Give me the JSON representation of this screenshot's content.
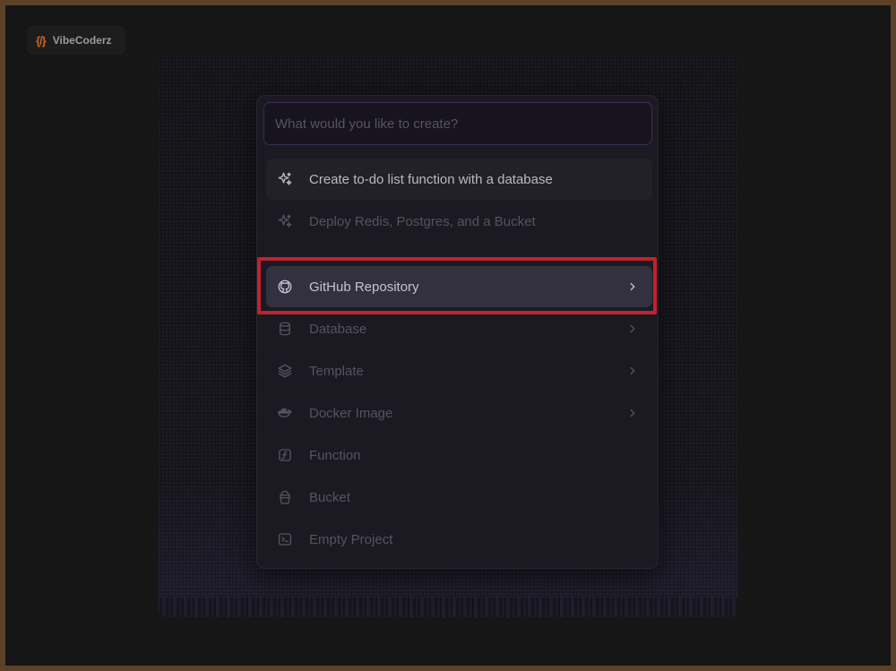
{
  "brand": {
    "logo": "{/}",
    "name": "VibeCoderz"
  },
  "search": {
    "placeholder": "What would you like to create?",
    "value": ""
  },
  "suggestions": [
    {
      "label": "Create to-do list function with a database",
      "icon": "sparkles-icon"
    },
    {
      "label": "Deploy Redis, Postgres, and a Bucket",
      "icon": "sparkles-icon"
    }
  ],
  "options": [
    {
      "label": "GitHub Repository",
      "icon": "github-icon",
      "has_submenu": true
    },
    {
      "label": "Database",
      "icon": "database-icon",
      "has_submenu": true
    },
    {
      "label": "Template",
      "icon": "layers-icon",
      "has_submenu": true
    },
    {
      "label": "Docker Image",
      "icon": "docker-icon",
      "has_submenu": true
    },
    {
      "label": "Function",
      "icon": "function-icon",
      "has_submenu": false
    },
    {
      "label": "Bucket",
      "icon": "bucket-icon",
      "has_submenu": false
    },
    {
      "label": "Empty Project",
      "icon": "terminal-icon",
      "has_submenu": false
    }
  ],
  "colors": {
    "brand_accent": "#c9642a",
    "search_border": "#3d2a55",
    "highlight": "#c0232e",
    "selected_bg": "#34313f"
  }
}
